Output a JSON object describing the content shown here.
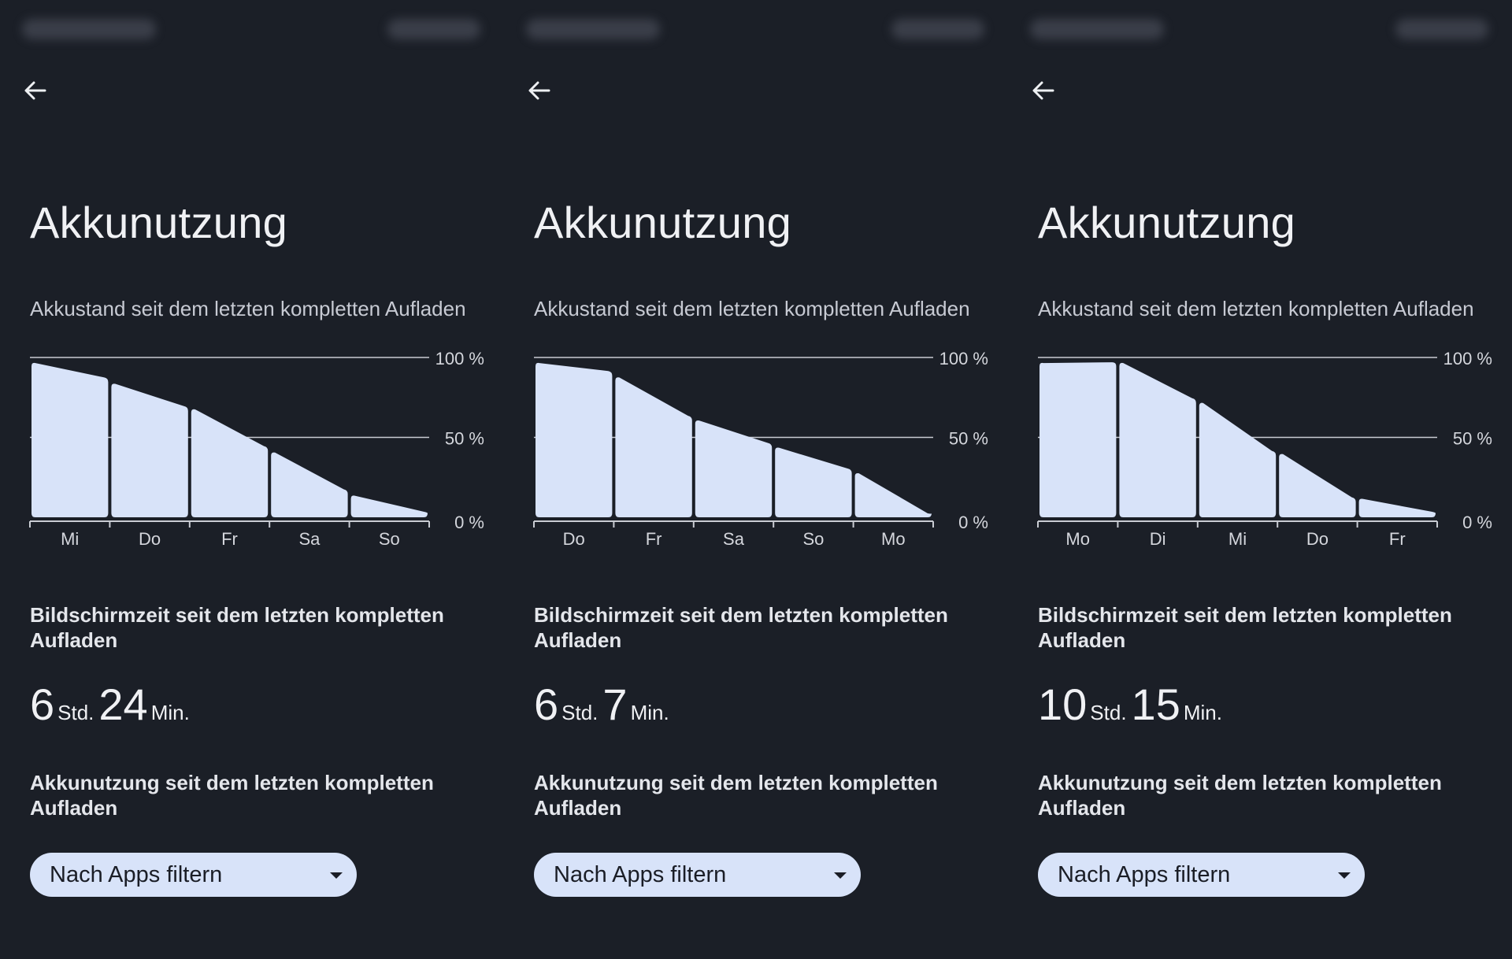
{
  "screens": [
    {
      "title": "Akkunutzung",
      "chart_caption": "Akkustand seit dem letzten kompletten Aufladen",
      "screen_time_title": "Bildschirmzeit seit dem letzten kompletten Aufladen",
      "screen_time": {
        "hours": "6",
        "hours_unit": "Std.",
        "minutes": "24",
        "minutes_unit": "Min."
      },
      "usage_title": "Akkunutzung seit dem letzten kompletten Aufladen",
      "filter_label": "Nach Apps filtern"
    },
    {
      "title": "Akkunutzung",
      "chart_caption": "Akkustand seit dem letzten kompletten Aufladen",
      "screen_time_title": "Bildschirmzeit seit dem letzten kompletten Aufladen",
      "screen_time": {
        "hours": "6",
        "hours_unit": "Std.",
        "minutes": "7",
        "minutes_unit": "Min."
      },
      "usage_title": "Akkunutzung seit dem letzten kompletten Aufladen",
      "filter_label": "Nach Apps filtern"
    },
    {
      "title": "Akkunutzung",
      "chart_caption": "Akkustand seit dem letzten kompletten Aufladen",
      "screen_time_title": "Bildschirmzeit seit dem letzten kompletten Aufladen",
      "screen_time": {
        "hours": "10",
        "hours_unit": "Std.",
        "minutes": "15",
        "minutes_unit": "Min."
      },
      "usage_title": "Akkunutzung seit dem letzten kompletten Aufladen",
      "filter_label": "Nach Apps filtern"
    }
  ],
  "icons": {
    "back": "arrow-left-icon",
    "dropdown": "caret-down-icon"
  },
  "colors": {
    "background": "#1b1f27",
    "bar_fill": "#d8e3f9",
    "gridline": "#c9ccd3",
    "text": "#e9eaee",
    "filter_bg": "#d8e3f9"
  },
  "chart_data": [
    {
      "type": "area",
      "y_ticks": [
        "100 %",
        "50 %",
        "0 %"
      ],
      "ylim": [
        0,
        100
      ],
      "categories": [
        "Mi",
        "Do",
        "Fr",
        "Sa",
        "So"
      ],
      "values": [
        [
          97,
          87
        ],
        [
          84,
          69
        ],
        [
          68,
          44
        ],
        [
          41,
          17
        ],
        [
          14,
          3
        ]
      ]
    },
    {
      "type": "area",
      "y_ticks": [
        "100 %",
        "50 %",
        "0 %"
      ],
      "ylim": [
        0,
        100
      ],
      "categories": [
        "Do",
        "Fr",
        "Sa",
        "So",
        "Mo"
      ],
      "values": [
        [
          97,
          91
        ],
        [
          88,
          63
        ],
        [
          61,
          46
        ],
        [
          44,
          30
        ],
        [
          28,
          2
        ]
      ]
    },
    {
      "type": "area",
      "y_ticks": [
        "100 %",
        "50 %",
        "0 %"
      ],
      "ylim": [
        0,
        100
      ],
      "categories": [
        "Mo",
        "Di",
        "Mi",
        "Do",
        "Fr"
      ],
      "values": [
        [
          97,
          97
        ],
        [
          97,
          74
        ],
        [
          72,
          41
        ],
        [
          40,
          12
        ],
        [
          12,
          3
        ]
      ]
    }
  ]
}
